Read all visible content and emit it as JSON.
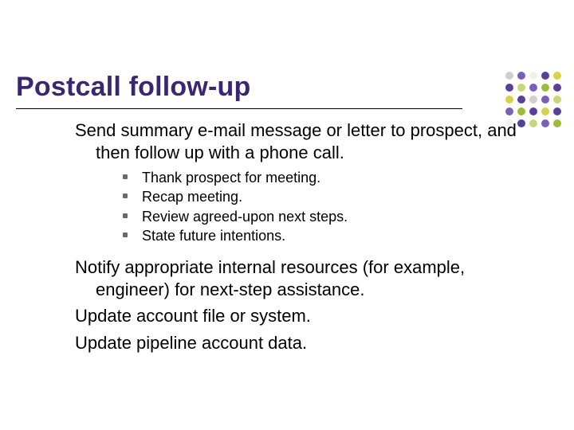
{
  "title": "Postcall follow-up",
  "intro": "Send summary e-mail message or letter to prospect, and then follow up with a phone call.",
  "bullets": [
    "Thank prospect for meeting.",
    "Recap meeting.",
    "Review agreed-upon next steps.",
    "State future intentions."
  ],
  "tail": [
    "Notify appropriate internal resources (for example, engineer) for next-step assistance.",
    "Update account file or system.",
    "Update pipeline account data."
  ]
}
